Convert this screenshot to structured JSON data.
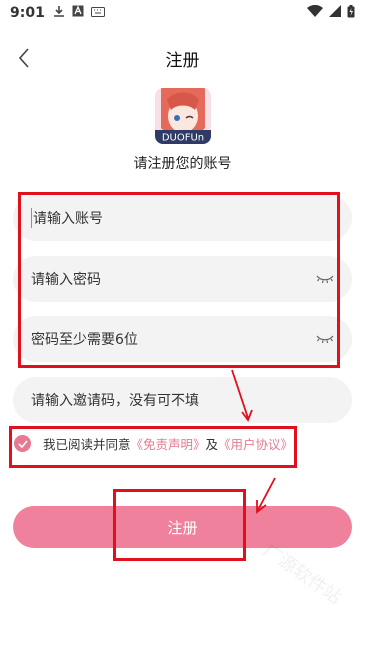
{
  "status_bar": {
    "time": "9:01"
  },
  "header": {
    "title": "注册"
  },
  "logo": {
    "brand_text": "DUOFUn"
  },
  "subtitle": "请注册您的账号",
  "form": {
    "account_placeholder": "请输入账号",
    "password_placeholder": "请输入密码",
    "confirm_placeholder": "密码至少需要6位",
    "invite_placeholder": "请输入邀请码，没有可不填"
  },
  "agreement": {
    "prefix": "我已阅读并同意",
    "disclaimer_link": "《免责声明》",
    "and": "及",
    "user_agreement_link": "《用户协议》",
    "checked": true
  },
  "submit_label": "注册",
  "watermark": "广源软件站",
  "colors": {
    "accent": "#f0819d",
    "link": "#e57a92",
    "annotation": "#e0101d"
  }
}
